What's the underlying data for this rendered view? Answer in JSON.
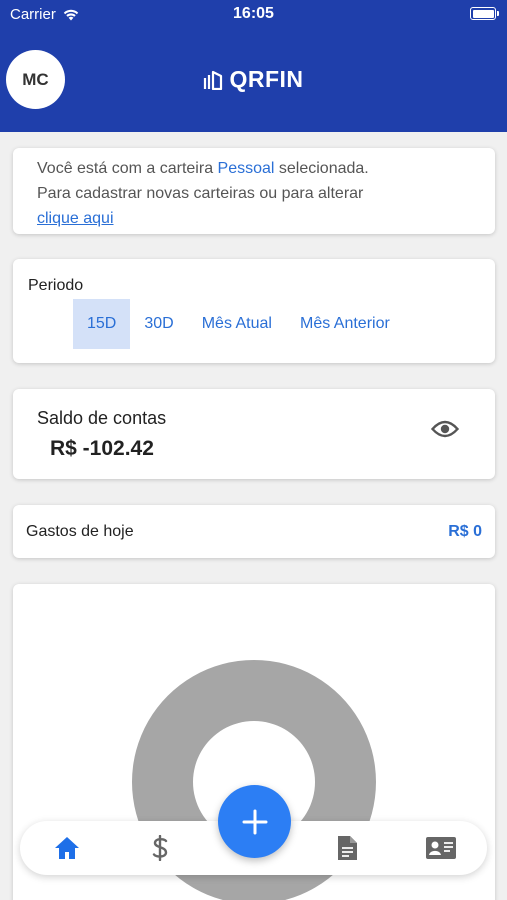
{
  "status_bar": {
    "carrier": "Carrier",
    "time": "16:05"
  },
  "header": {
    "avatar_initials": "MC",
    "logo_text": "QRFIN"
  },
  "wallet_notice": {
    "line1_prefix": "Você está com a carteira ",
    "wallet_name": "Pessoal",
    "line1_suffix": " selecionada.",
    "line2": "Para cadastrar novas carteiras ou para alterar",
    "link": "clique aqui"
  },
  "period": {
    "label": "Periodo",
    "options": [
      "15D",
      "30D",
      "Mês Atual",
      "Mês Anterior"
    ],
    "selected": "15D"
  },
  "balance": {
    "title": "Saldo de contas",
    "value": "R$ -102.42"
  },
  "today_spending": {
    "label": "Gastos de hoje",
    "value": "R$ 0"
  },
  "colors": {
    "header_blue": "#1f3fab",
    "accent_blue": "#2a6fd6",
    "fab_blue": "#2c7ef4",
    "donut_gray": "#a6a6a6"
  },
  "nav": {
    "items": [
      "home-icon",
      "dollar-icon",
      "add-icon",
      "document-icon",
      "contact-card-icon"
    ],
    "active": "home-icon"
  }
}
